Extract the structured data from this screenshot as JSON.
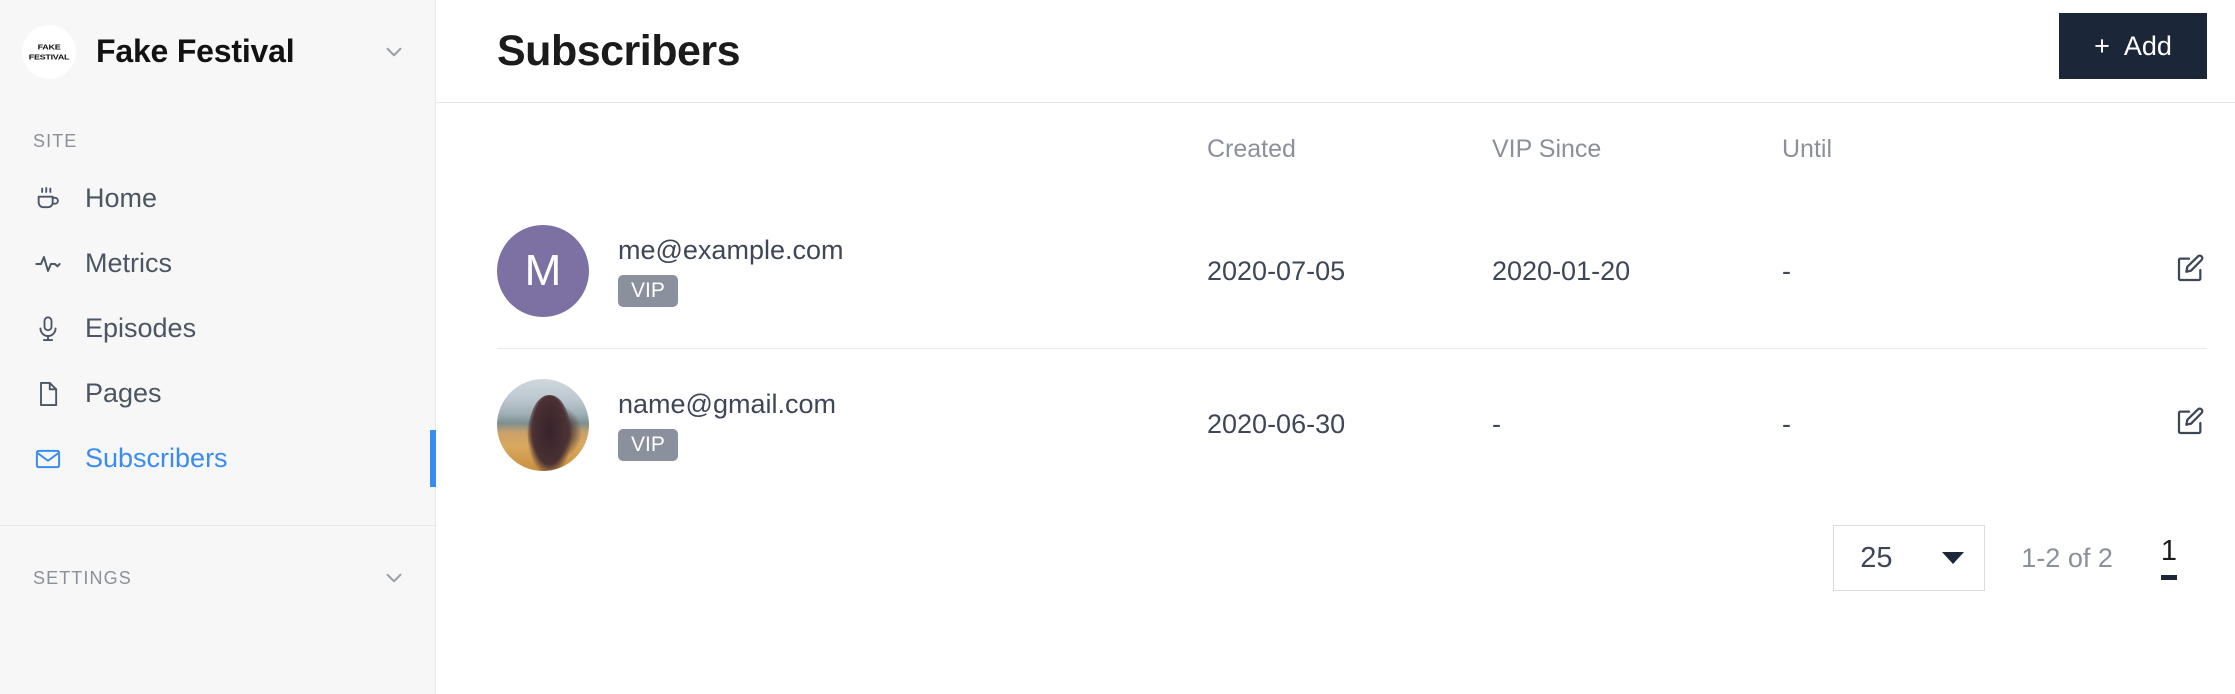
{
  "sidebar": {
    "brand": {
      "name": "Fake Festival",
      "logo_line1": "FAKE",
      "logo_line2": "FESTIVAL",
      "chevron_icon": "chevron-down-icon"
    },
    "site_section_label": "SITE",
    "items": [
      {
        "label": "Home",
        "icon": "coffee-cup-icon",
        "active": false
      },
      {
        "label": "Metrics",
        "icon": "activity-icon",
        "active": false
      },
      {
        "label": "Episodes",
        "icon": "microphone-icon",
        "active": false
      },
      {
        "label": "Pages",
        "icon": "file-icon",
        "active": false
      },
      {
        "label": "Subscribers",
        "icon": "envelope-icon",
        "active": true
      }
    ],
    "settings_section_label": "SETTINGS",
    "settings_chevron_icon": "chevron-down-icon"
  },
  "header": {
    "title": "Subscribers",
    "add_button_label": "Add",
    "add_button_plus": "+",
    "add_button_icon": "plus-icon"
  },
  "table": {
    "columns": [
      "",
      "Created",
      "VIP Since",
      "Until",
      ""
    ],
    "rows": [
      {
        "avatar_type": "initial",
        "avatar_initial": "M",
        "avatar_color": "#7d71a3",
        "email": "me@example.com",
        "badge": "VIP",
        "created": "2020-07-05",
        "vip_since": "2020-01-20",
        "until": "-",
        "edit_icon": "edit-pencil-icon"
      },
      {
        "avatar_type": "photo",
        "avatar_initial": "",
        "avatar_color": "#b59468",
        "email": "name@gmail.com",
        "badge": "VIP",
        "created": "2020-06-30",
        "vip_since": "-",
        "until": "-",
        "edit_icon": "edit-pencil-icon"
      }
    ]
  },
  "pagination": {
    "rows_per_page": "25",
    "range_text": "1-2 of 2",
    "current_page": "1"
  },
  "colors": {
    "accent_blue": "#3b8cf0",
    "dark_navy": "#1c2639",
    "sidebar_bg": "#f7f7f7",
    "muted_text": "#8b9099",
    "body_text": "#3f4757",
    "badge_gray": "#8b919c"
  }
}
